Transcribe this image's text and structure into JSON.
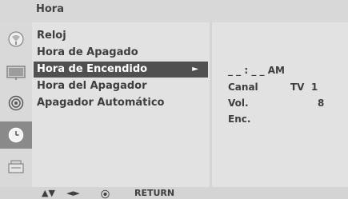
{
  "title": "Hora",
  "menu": {
    "items": [
      {
        "label": "Reloj"
      },
      {
        "label": "Hora de Apagado"
      },
      {
        "label": "Hora de Encendido",
        "selected_arrow": "►"
      },
      {
        "label": "Hora del Apagador"
      },
      {
        "label": "Apagador Automático"
      }
    ]
  },
  "detail": {
    "time": "_ _ : _ _ AM",
    "canal_label": "Canal",
    "canal_value": "TV  1",
    "vol_label": "Vol.",
    "vol_value": "8",
    "enc_label": "Enc."
  },
  "sidebar_icons": [
    {
      "name": "satellite-dish-icon"
    },
    {
      "name": "picture-icon"
    },
    {
      "name": "audio-icon"
    },
    {
      "name": "clock-icon",
      "active": true
    },
    {
      "name": "settings-icon"
    }
  ],
  "footer": {
    "updown": "▲▼",
    "leftright": "◄►",
    "ok": "⦿",
    "return": "RETURN"
  }
}
